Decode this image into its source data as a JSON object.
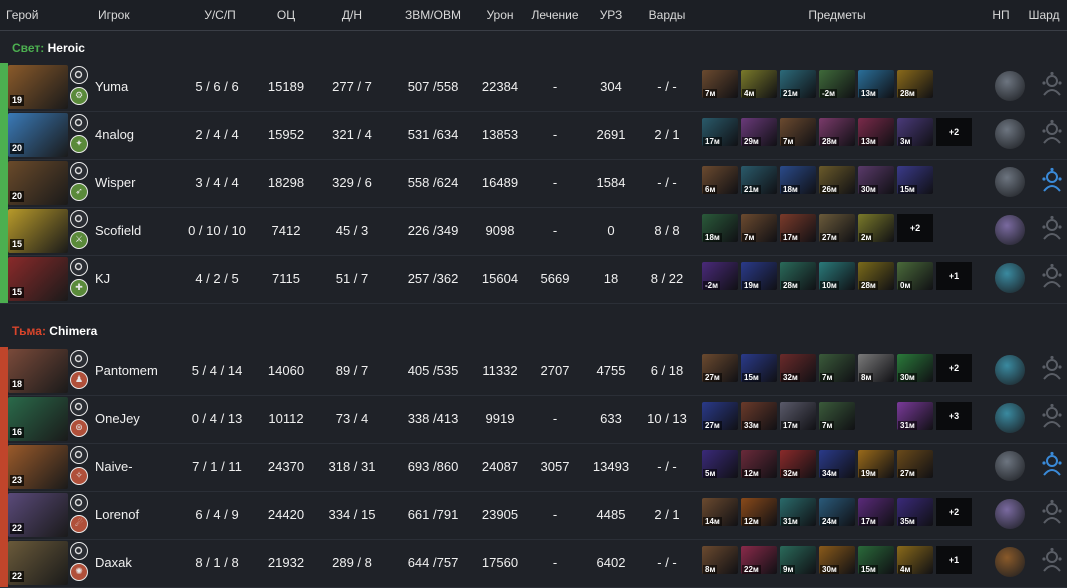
{
  "headers": {
    "hero": "Герой",
    "player": "Игрок",
    "kda": "У/С/П",
    "nw": "ОЦ",
    "lhd": "Д/Н",
    "gpm": "ЗВМ/ОВМ",
    "damage": "Урон",
    "heal": "Лечение",
    "tower": "УРЗ",
    "wards": "Варды",
    "items": "Предметы",
    "np": "НП",
    "shard": "Шард"
  },
  "radiant": {
    "side": "Свет:",
    "team": "Heroic",
    "color": "#4caf50",
    "side_color": "#4caf50"
  },
  "dire": {
    "side": "Тьма:",
    "team": "Chimera",
    "color": "#c0452b",
    "side_color": "#d9452b"
  },
  "players": [
    {
      "team": "radiant",
      "level": "19",
      "name": "Yuma",
      "kda": "5 / 6 / 6",
      "nw": "15189",
      "lhd": "277 / 7",
      "gpm": "507 /558",
      "damage": "22384",
      "heal": "-",
      "tower": "304",
      "wards": "- / -",
      "portrait": "#8a5a2a",
      "items": [
        {
          "t": "7м",
          "c": "#6b4a2f"
        },
        {
          "t": "4м",
          "c": "#7a7a2a"
        },
        {
          "t": "21м",
          "c": "#2c6a7a"
        },
        {
          "t": "-2м",
          "c": "#3f6a3a"
        },
        {
          "t": "13м",
          "c": "#2a6f9a"
        },
        {
          "t": "28м",
          "c": "#8a6a1a"
        }
      ],
      "more": "",
      "np": "#6d7580",
      "shard": "off"
    },
    {
      "team": "radiant",
      "level": "20",
      "name": "4nalog",
      "kda": "2 / 4 / 4",
      "nw": "15952",
      "lhd": "321 / 4",
      "gpm": "531 /634",
      "damage": "13853",
      "heal": "-",
      "tower": "2691",
      "wards": "2 / 1",
      "portrait": "#3a7ab8",
      "items": [
        {
          "t": "17м",
          "c": "#2a5a6a"
        },
        {
          "t": "29м",
          "c": "#6a3a7a"
        },
        {
          "t": "7м",
          "c": "#6b4a2f"
        },
        {
          "t": "28м",
          "c": "#7a3a6a"
        },
        {
          "t": "13м",
          "c": "#7a2a4a"
        },
        {
          "t": "3м",
          "c": "#4a3a7a"
        }
      ],
      "more": "+2",
      "np": "#6d7580",
      "shard": "off"
    },
    {
      "team": "radiant",
      "level": "20",
      "name": "Wisper",
      "kda": "3 / 4 / 4",
      "nw": "18298",
      "lhd": "329 / 6",
      "gpm": "558 /624",
      "damage": "16489",
      "heal": "-",
      "tower": "1584",
      "wards": "- / -",
      "portrait": "#6a4a2a",
      "items": [
        {
          "t": "6м",
          "c": "#6b4a2f"
        },
        {
          "t": "21м",
          "c": "#2a5a6a"
        },
        {
          "t": "18м",
          "c": "#2a4a8a"
        },
        {
          "t": "26м",
          "c": "#6a5a2a"
        },
        {
          "t": "30м",
          "c": "#5a3a6a"
        },
        {
          "t": "15м",
          "c": "#3a3a8a"
        }
      ],
      "more": "",
      "np": "#6d7580",
      "shard": "on"
    },
    {
      "team": "radiant",
      "level": "15",
      "name": "Scofield",
      "kda": "0 / 10 / 10",
      "nw": "7412",
      "lhd": "45 / 3",
      "gpm": "226 /349",
      "damage": "9098",
      "heal": "-",
      "tower": "0",
      "wards": "8 / 8",
      "portrait": "#b89a2a",
      "items": [
        {
          "t": "18м",
          "c": "#2a5a3a"
        },
        {
          "t": "7м",
          "c": "#6b4a2f"
        },
        {
          "t": "17м",
          "c": "#7a3a2a"
        },
        {
          "t": "27м",
          "c": "#6a5a3a"
        },
        {
          "t": "2м",
          "c": "#7a7a2a"
        }
      ],
      "more": "+2",
      "np": "#7a6aa0",
      "shard": "off"
    },
    {
      "team": "radiant",
      "level": "15",
      "name": "KJ",
      "kda": "4 / 2 / 5",
      "nw": "7115",
      "lhd": "51 / 7",
      "gpm": "257 /362",
      "damage": "15604",
      "heal": "5669",
      "tower": "18",
      "wards": "8 / 22",
      "portrait": "#8a2a2a",
      "items": [
        {
          "t": "-2м",
          "c": "#4a2a7a"
        },
        {
          "t": "19м",
          "c": "#2a3a8a"
        },
        {
          "t": "28м",
          "c": "#2a6a5a"
        },
        {
          "t": "10м",
          "c": "#2a7a7a"
        },
        {
          "t": "28м",
          "c": "#7a6a1a"
        },
        {
          "t": "0м",
          "c": "#4a6a3a"
        }
      ],
      "more": "+1",
      "np": "#3a8aa0",
      "shard": "off"
    },
    {
      "team": "dire",
      "level": "18",
      "name": "Pantomem",
      "kda": "5 / 4 / 14",
      "nw": "14060",
      "lhd": "89 / 7",
      "gpm": "405 /535",
      "damage": "11332",
      "heal": "2707",
      "tower": "4755",
      "wards": "6 / 18",
      "portrait": "#7a4a3a",
      "items": [
        {
          "t": "27м",
          "c": "#6b4a2f"
        },
        {
          "t": "15м",
          "c": "#2a3a8a"
        },
        {
          "t": "32м",
          "c": "#6a2a2a"
        },
        {
          "t": "7м",
          "c": "#3a5a3a"
        },
        {
          "t": "8м",
          "c": "#7a7a7a"
        },
        {
          "t": "30м",
          "c": "#2a7a3a"
        }
      ],
      "more": "+2",
      "np": "#3a8aa0",
      "shard": "off"
    },
    {
      "team": "dire",
      "level": "16",
      "name": "OneJey",
      "kda": "0 / 4 / 13",
      "nw": "10112",
      "lhd": "73 / 4",
      "gpm": "338 /413",
      "damage": "9919",
      "heal": "-",
      "tower": "633",
      "wards": "10 / 13",
      "portrait": "#2a6a4a",
      "items": [
        {
          "t": "27м",
          "c": "#2a3a8a"
        },
        {
          "t": "33м",
          "c": "#6a3a2a"
        },
        {
          "t": "17м",
          "c": "#5a5a6a"
        },
        {
          "t": "7м",
          "c": "#3a5a3a"
        },
        {
          "t": "",
          "c": "#1f2228"
        },
        {
          "t": "31м",
          "c": "#7a3a9a"
        }
      ],
      "more": "+3",
      "np": "#3a8aa0",
      "shard": "off"
    },
    {
      "team": "dire",
      "level": "23",
      "name": "Naive-",
      "kda": "7 / 1 / 11",
      "nw": "24370",
      "lhd": "318 / 31",
      "gpm": "693 /860",
      "damage": "24087",
      "heal": "3057",
      "tower": "13493",
      "wards": "- / -",
      "portrait": "#9a5a2a",
      "items": [
        {
          "t": "5м",
          "c": "#3a2a7a"
        },
        {
          "t": "12м",
          "c": "#6a2a3a"
        },
        {
          "t": "32м",
          "c": "#8a2a2a"
        },
        {
          "t": "34м",
          "c": "#2a3a8a"
        },
        {
          "t": "19м",
          "c": "#9a6a1a"
        },
        {
          "t": "27м",
          "c": "#6a4a1a"
        }
      ],
      "more": "",
      "np": "#6d7580",
      "shard": "on"
    },
    {
      "team": "dire",
      "level": "22",
      "name": "Lorenof",
      "kda": "6 / 4 / 9",
      "nw": "24420",
      "lhd": "334 / 15",
      "gpm": "661 /791",
      "damage": "23905",
      "heal": "-",
      "tower": "4485",
      "wards": "2 / 1",
      "portrait": "#5a4a7a",
      "items": [
        {
          "t": "14м",
          "c": "#6b4a2f"
        },
        {
          "t": "12м",
          "c": "#8a4a1a"
        },
        {
          "t": "31м",
          "c": "#2a6a6a"
        },
        {
          "t": "24м",
          "c": "#2a5a7a"
        },
        {
          "t": "17м",
          "c": "#5a2a7a"
        },
        {
          "t": "35м",
          "c": "#3a2a7a"
        }
      ],
      "more": "+2",
      "np": "#7a6aa0",
      "shard": "off"
    },
    {
      "team": "dire",
      "level": "22",
      "name": "Daxak",
      "kda": "8 / 1 / 8",
      "nw": "21932",
      "lhd": "289 / 8",
      "gpm": "644 /757",
      "damage": "17560",
      "heal": "-",
      "tower": "6402",
      "wards": "- / -",
      "portrait": "#6a5a3a",
      "items": [
        {
          "t": "8м",
          "c": "#6b4a2f"
        },
        {
          "t": "22м",
          "c": "#8a2a4a"
        },
        {
          "t": "9м",
          "c": "#2a6a5a"
        },
        {
          "t": "30м",
          "c": "#8a5a1a"
        },
        {
          "t": "15м",
          "c": "#2a6a3a"
        },
        {
          "t": "4м",
          "c": "#8a6a1a"
        }
      ],
      "more": "+1",
      "np": "#8a5a2a",
      "shard": "off"
    }
  ]
}
